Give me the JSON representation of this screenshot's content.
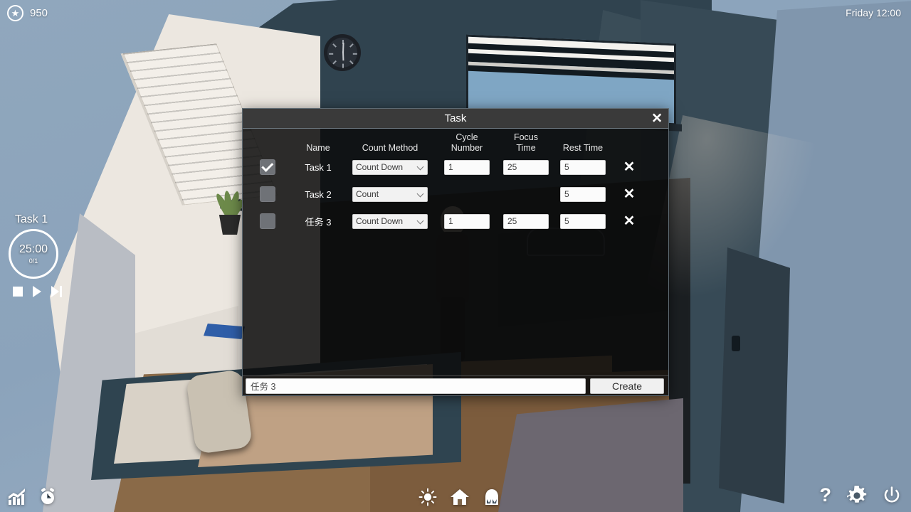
{
  "hud": {
    "coin_icon": "coin-star-icon",
    "coin_value": "950",
    "datetime": "Friday 12:00"
  },
  "timer": {
    "task_label": "Task 1",
    "time_remaining": "25:00",
    "cycle_progress": "0/1",
    "controls": [
      {
        "name": "stop-button",
        "icon": "stop-icon"
      },
      {
        "name": "play-button",
        "icon": "play-icon"
      },
      {
        "name": "skip-next-button",
        "icon": "skip-next-icon"
      }
    ]
  },
  "bottom_left_icons": [
    {
      "name": "statistics-icon",
      "label": "Statistics"
    },
    {
      "name": "alarm-clock-icon",
      "label": "Alarm"
    }
  ],
  "bottom_center_icons": [
    {
      "name": "brightness-icon",
      "label": "Light"
    },
    {
      "name": "home-icon",
      "label": "Home"
    },
    {
      "name": "character-icon",
      "label": "Character"
    }
  ],
  "bottom_right_icons": [
    {
      "name": "help-icon",
      "label": "?"
    },
    {
      "name": "settings-gear-icon",
      "label": "Settings"
    },
    {
      "name": "power-icon",
      "label": "Power"
    }
  ],
  "dialog": {
    "title": "Task",
    "close_label": "✕",
    "columns": {
      "name": "Name",
      "count_method": "Count Method",
      "cycle_number_l1": "Cycle",
      "cycle_number_l2": "Number",
      "focus_time_l1": "Focus",
      "focus_time_l2": "Time",
      "rest_time": "Rest Time"
    },
    "rows": [
      {
        "checked": true,
        "name": "Task 1",
        "count_method": "Count Down",
        "cycle_number": "1",
        "focus_time": "25",
        "rest_time": "5",
        "delete_label": "✕",
        "has_cycle": true,
        "has_focus": true
      },
      {
        "checked": false,
        "name": "Task 2",
        "count_method": "Count",
        "cycle_number": "",
        "focus_time": "",
        "rest_time": "5",
        "delete_label": "✕",
        "has_cycle": false,
        "has_focus": false
      },
      {
        "checked": false,
        "name": "任务 3",
        "count_method": "Count Down",
        "cycle_number": "1",
        "focus_time": "25",
        "rest_time": "5",
        "delete_label": "✕",
        "has_cycle": true,
        "has_focus": true
      }
    ],
    "count_method_options": [
      "Count Down",
      "Count"
    ],
    "footer": {
      "new_task_name": "任务 3",
      "new_task_placeholder": "任务 3",
      "create_label": "Create"
    }
  },
  "colors": {
    "sky": "#8ba3bb",
    "wall_teal": "#374a56",
    "wall_cream": "#ece7e0",
    "floor_wood": "#8a6a48",
    "dialog_title_bar": "#3a3a3a",
    "field_bg": "#fbfbfb",
    "accent_white": "#ffffff"
  }
}
